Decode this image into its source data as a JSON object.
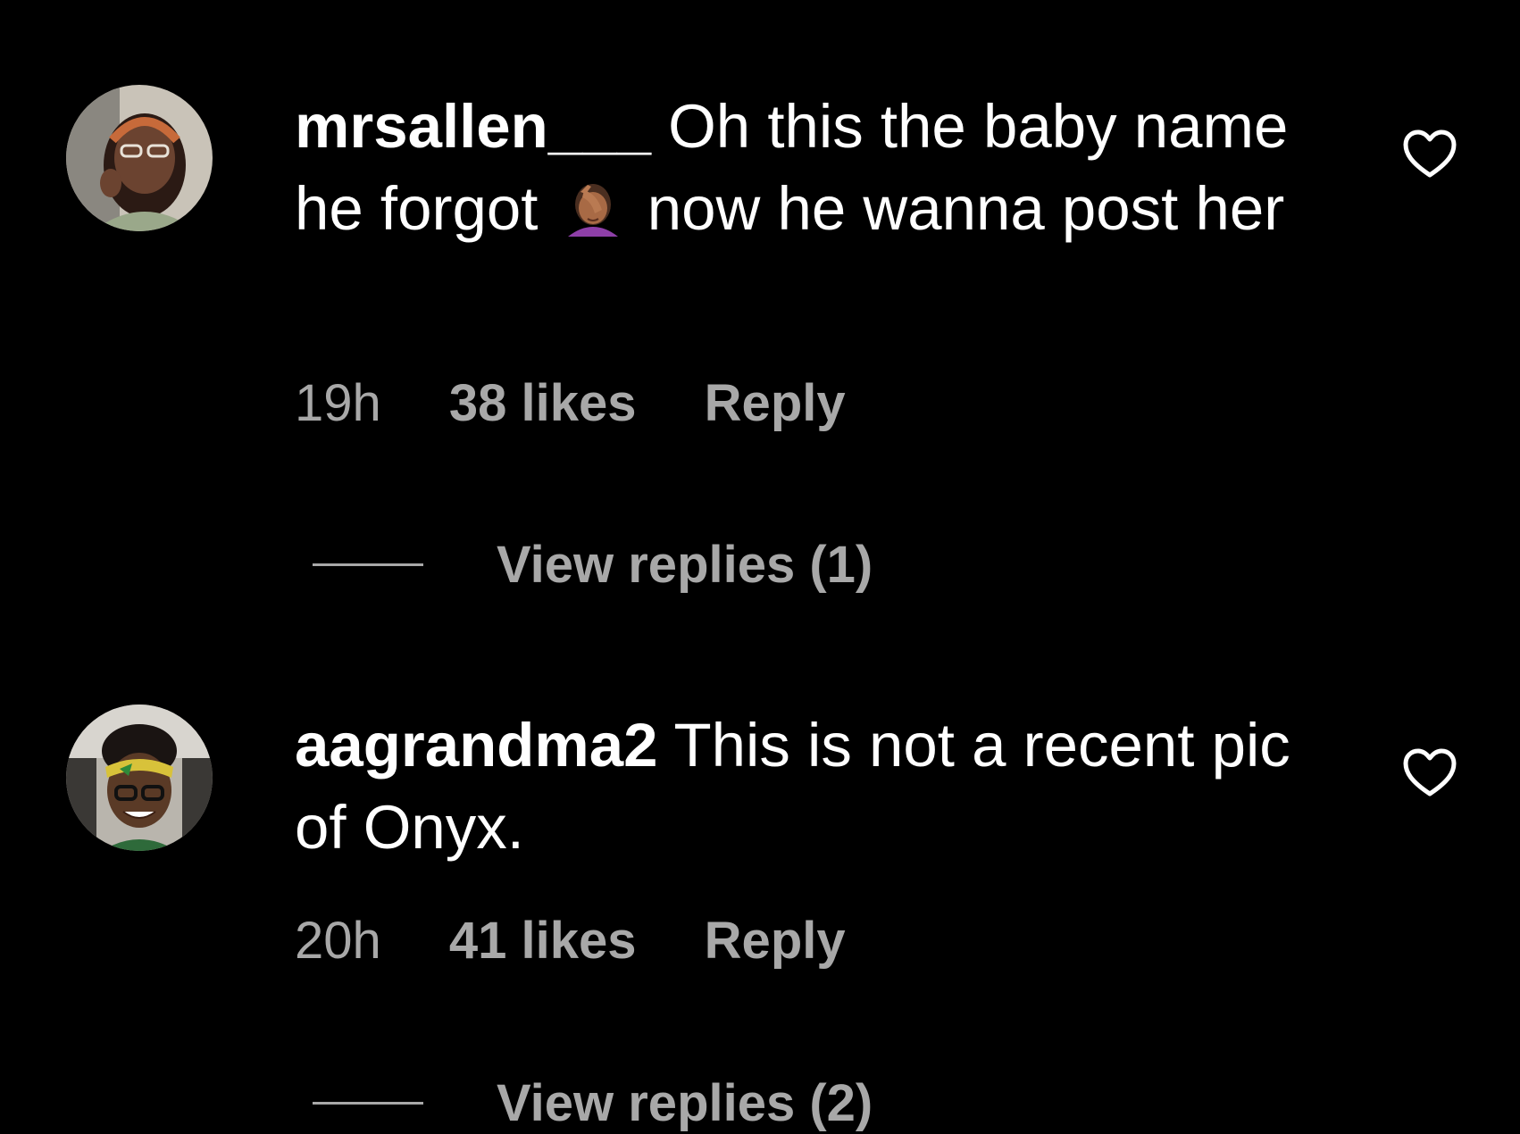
{
  "colors": {
    "background": "#000000",
    "primary_text": "#ffffff",
    "secondary_text": "#a8a8a8"
  },
  "comments": [
    {
      "username": "mrsallen___",
      "text_before_emoji": "Oh this the baby name he forgot",
      "emoji": "face-palm-emoji",
      "text_after_emoji": "now he wanna post her",
      "time": "19h",
      "likes": "38 likes",
      "reply_label": "Reply",
      "view_replies_label": "View replies (1)",
      "like_icon": "heart-outline-icon",
      "avatar_icon": "user-avatar"
    },
    {
      "username": "aagrandma2",
      "text": "This is not a recent pic of Onyx.",
      "time": "20h",
      "likes": "41 likes",
      "reply_label": "Reply",
      "view_replies_label": "View replies (2)",
      "like_icon": "heart-outline-icon",
      "avatar_icon": "user-avatar"
    }
  ]
}
